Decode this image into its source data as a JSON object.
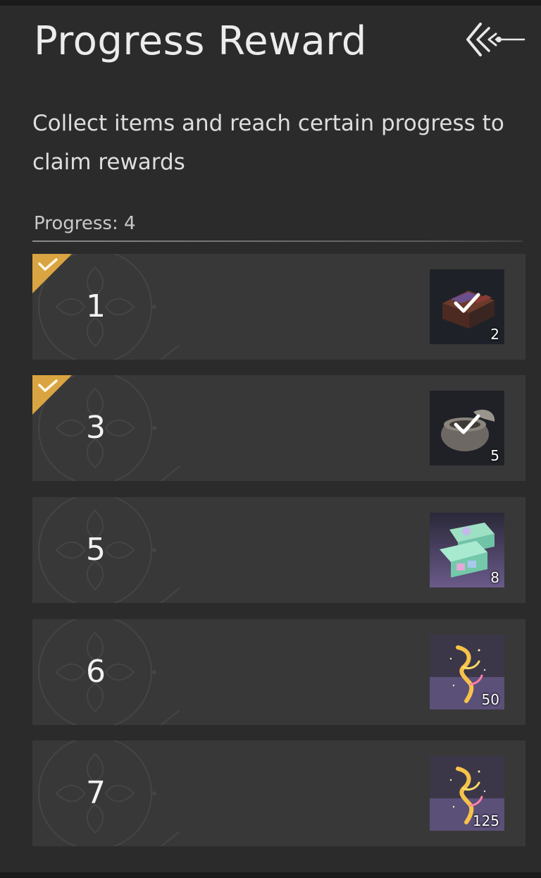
{
  "header": {
    "title": "Progress Reward",
    "description": "Collect items and reach certain progress to claim rewards",
    "progress_label": "Progress: 4"
  },
  "colors": {
    "panel_bg": "#2b2b2b",
    "row_bg": "#383838",
    "claimed_tag": "#d9a441"
  },
  "milestones": [
    {
      "threshold": "1",
      "claimed": true,
      "reward_qty": "2",
      "reward_icon": "treasure-box-icon"
    },
    {
      "threshold": "3",
      "claimed": true,
      "reward_qty": "5",
      "reward_icon": "stone-pot-icon"
    },
    {
      "threshold": "5",
      "claimed": false,
      "reward_qty": "8",
      "reward_icon": "jade-chest-icon"
    },
    {
      "threshold": "6",
      "claimed": false,
      "reward_qty": "50",
      "reward_icon": "golden-sparkle-icon"
    },
    {
      "threshold": "7",
      "claimed": false,
      "reward_qty": "125",
      "reward_icon": "golden-sparkle-icon"
    }
  ]
}
